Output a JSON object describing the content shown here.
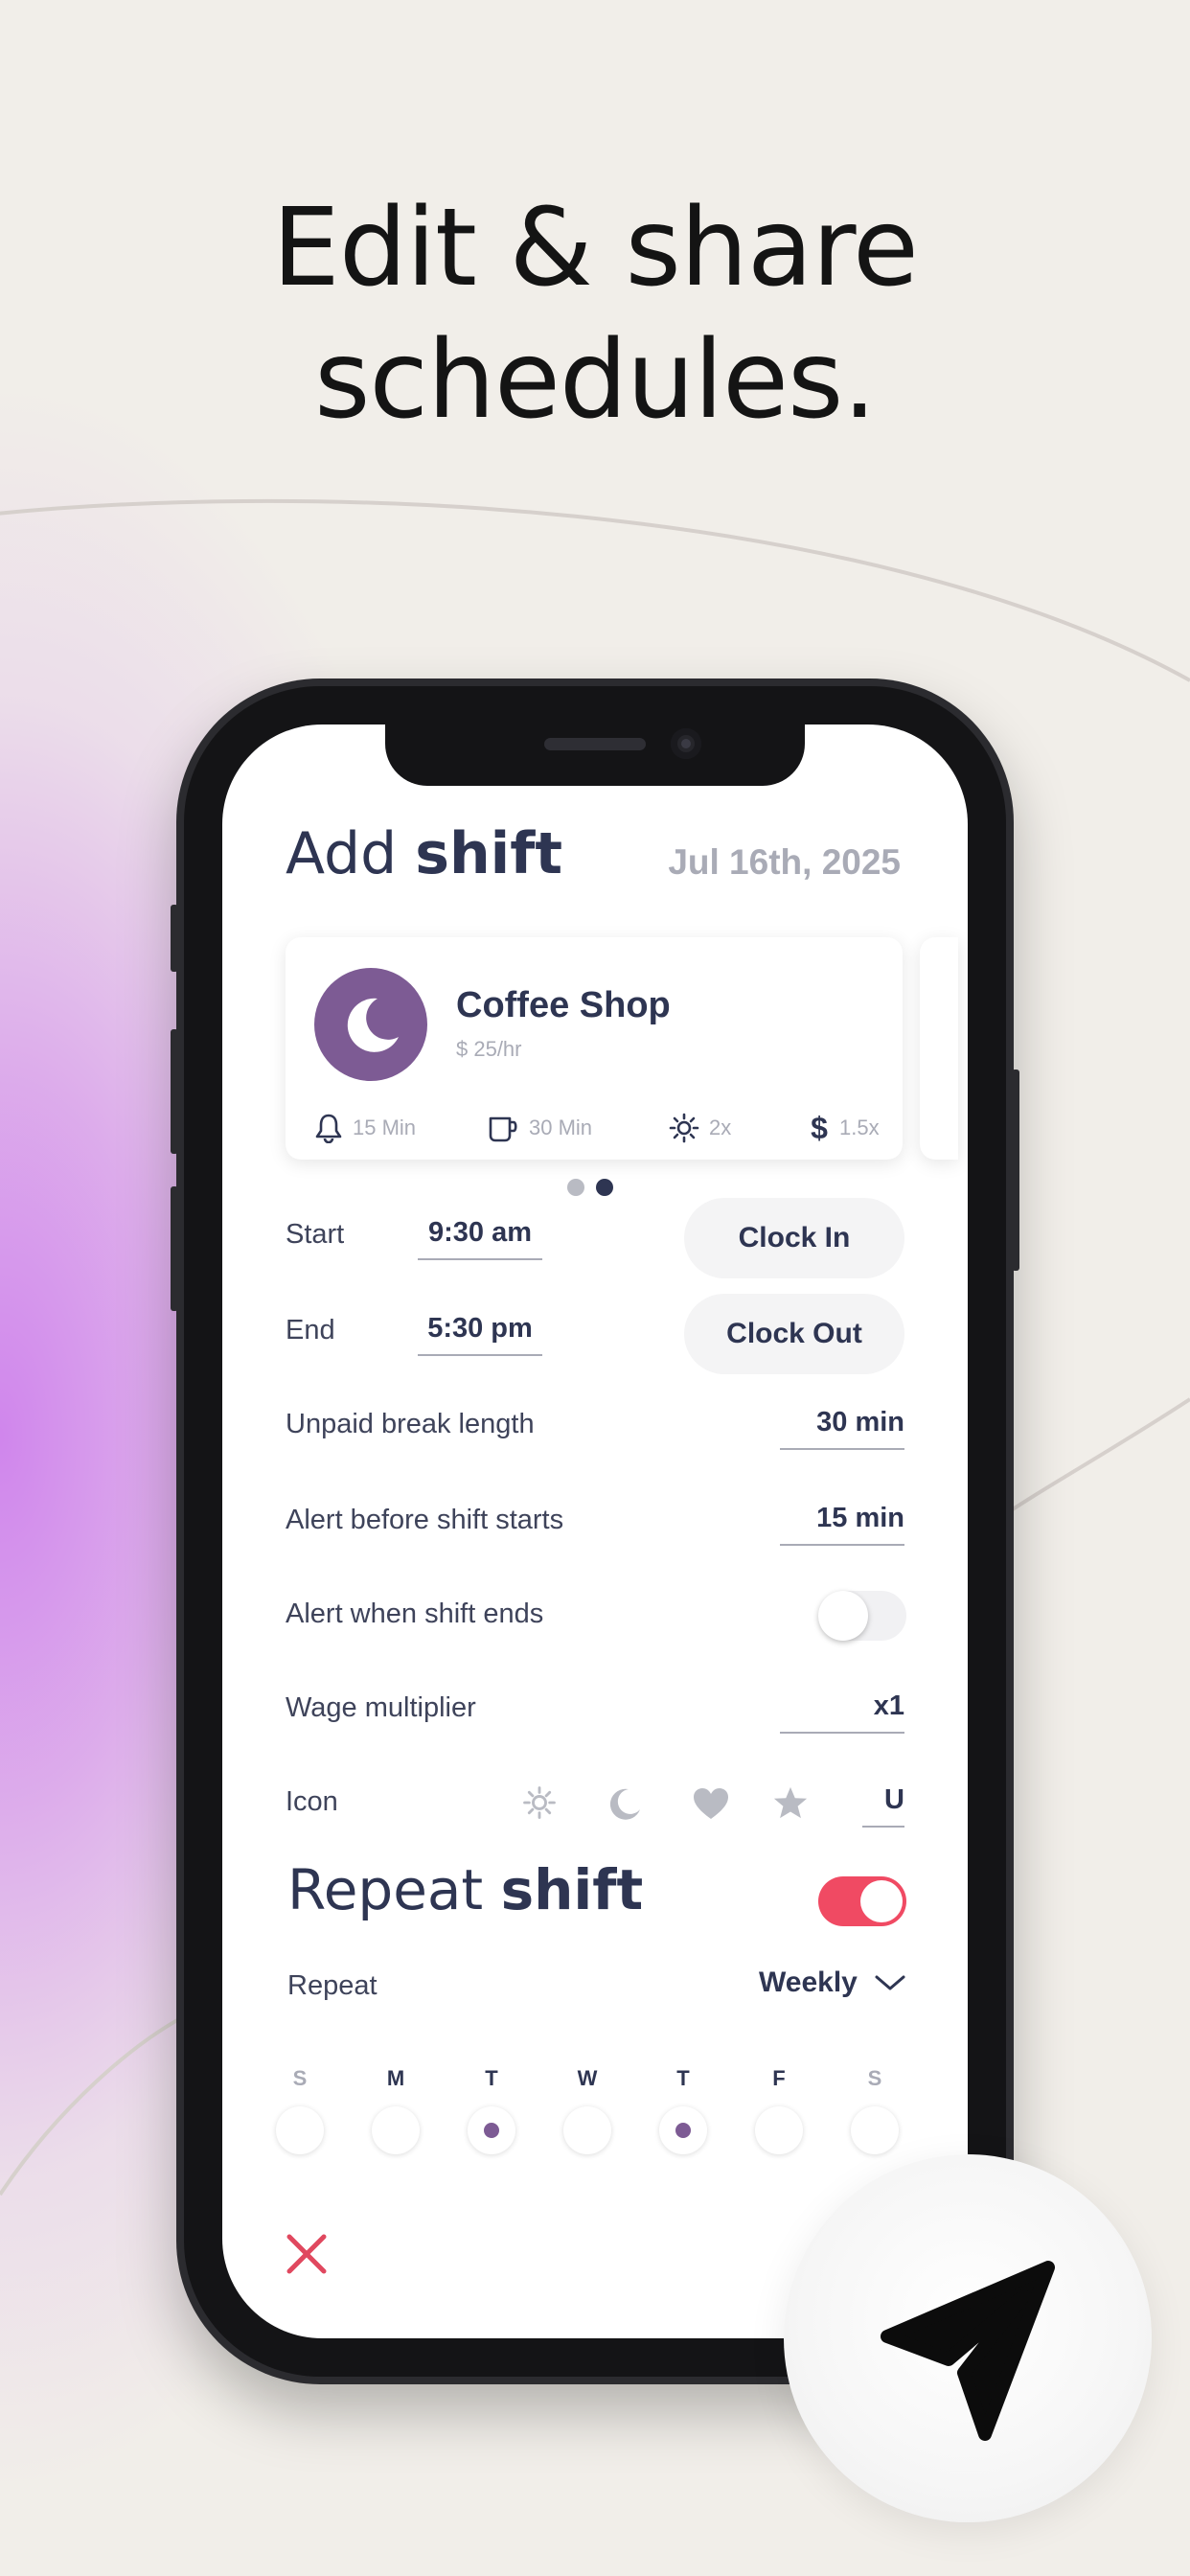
{
  "headline": {
    "line1": "Edit & share",
    "line2": "schedules."
  },
  "screen": {
    "title_regular": "Add",
    "title_bold": "shift",
    "date": "Jul 16th, 2025",
    "card": {
      "name": "Coffee Shop",
      "rate": "$ 25/hr",
      "avatar_icon": "moon-icon",
      "stats": [
        {
          "icon": "bell-icon",
          "label": "15 Min"
        },
        {
          "icon": "coffee-cup-icon",
          "label": "30 Min"
        },
        {
          "icon": "sun-icon",
          "label": "2x"
        },
        {
          "icon": "dollar-icon",
          "label": "1.5x"
        }
      ]
    },
    "pager": {
      "count": 2,
      "active": 2
    },
    "start": {
      "label": "Start",
      "value": "9:30 am",
      "button": "Clock In"
    },
    "end": {
      "label": "End",
      "value": "5:30 pm",
      "button": "Clock Out"
    },
    "unpaid_break": {
      "label": "Unpaid break length",
      "value": "30 min"
    },
    "alert_before": {
      "label": "Alert before shift starts",
      "value": "15 min"
    },
    "alert_end": {
      "label": "Alert when shift ends",
      "enabled": false
    },
    "wage_multiplier": {
      "label": "Wage multiplier",
      "value": "x1"
    },
    "icon_row": {
      "label": "Icon",
      "options": [
        "sun-icon",
        "moon-icon",
        "heart-icon",
        "star-icon"
      ],
      "custom_value": "U"
    },
    "repeat_title_regular": "Repeat",
    "repeat_title_bold": "shift",
    "repeat_enabled": true,
    "repeat": {
      "label": "Repeat",
      "value": "Weekly"
    },
    "days": [
      {
        "letter": "S",
        "selected": false,
        "active": false
      },
      {
        "letter": "M",
        "selected": false,
        "active": true
      },
      {
        "letter": "T",
        "selected": true,
        "active": true
      },
      {
        "letter": "W",
        "selected": false,
        "active": true
      },
      {
        "letter": "T",
        "selected": true,
        "active": true
      },
      {
        "letter": "F",
        "selected": false,
        "active": true
      },
      {
        "letter": "S",
        "selected": false,
        "active": false
      }
    ]
  },
  "colors": {
    "navy": "#2e3552",
    "purple": "#7d5b94",
    "toggle_on": "#f04a63",
    "close_red": "#e0485f",
    "muted": "#a9abb6"
  }
}
